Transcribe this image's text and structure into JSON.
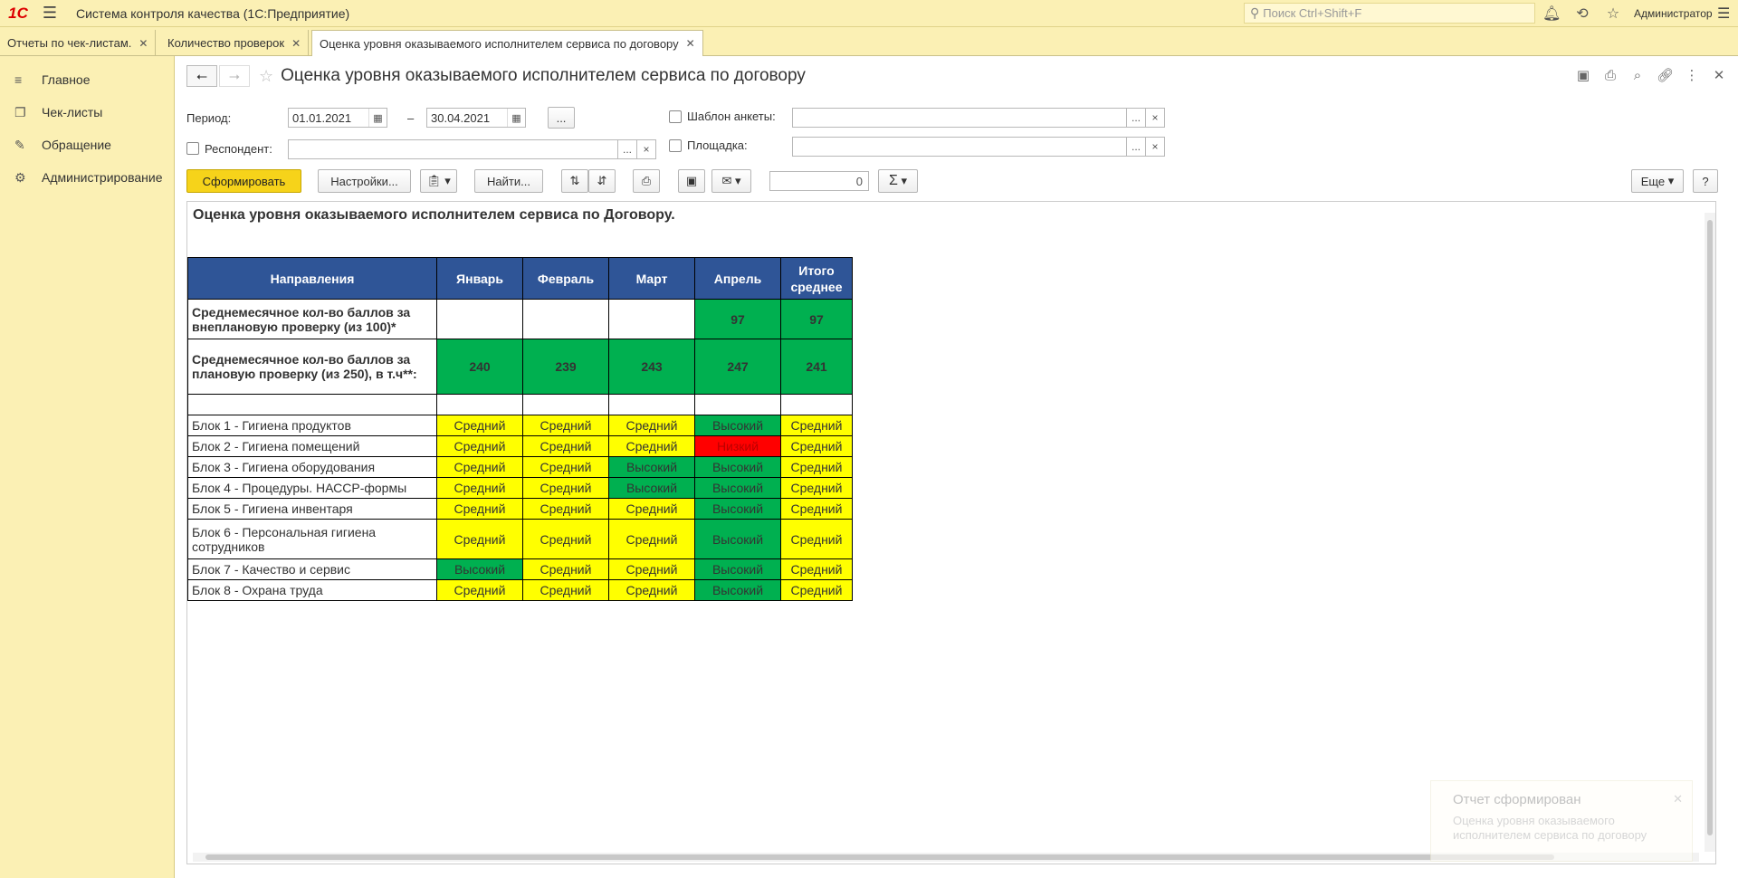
{
  "app": {
    "logo": "1С",
    "title": "Система контроля качества  (1С:Предприятие)",
    "search_placeholder": "Поиск Ctrl+Shift+F",
    "user": "Администратор"
  },
  "tabs": [
    {
      "label": "Отчеты по чек-листам."
    },
    {
      "label": "Количество проверок"
    },
    {
      "label": "Оценка уровня оказываемого исполнителем сервиса по договору"
    }
  ],
  "sidebar": {
    "items": [
      {
        "label": "Главное"
      },
      {
        "label": "Чек-листы"
      },
      {
        "label": "Обращение"
      },
      {
        "label": "Администрирование"
      }
    ]
  },
  "page": {
    "title": "Оценка уровня оказываемого исполнителем сервиса по договору"
  },
  "filters": {
    "period_label": "Период:",
    "date_from": "01.01.2021",
    "dash": "–",
    "date_to": "30.04.2021",
    "respondent_label": "Респондент:",
    "respondent_value": "",
    "template_label": "Шаблон анкеты:",
    "template_value": "",
    "site_label": "Площадка:",
    "site_value": "",
    "dots": "...",
    "clear": "×"
  },
  "toolbar": {
    "generate": "Сформировать",
    "settings": "Настройки...",
    "find": "Найти...",
    "counter": "0",
    "sum": "Σ",
    "more": "Еще",
    "help": "?"
  },
  "report": {
    "title": "Оценка уровня оказываемого исполнителем сервиса по Договору.",
    "headers": [
      "Направления",
      "Январь",
      "Февраль",
      "Март",
      "Апрель",
      "Итого среднее"
    ],
    "rows": [
      {
        "name": "Среднемесячное кол-во баллов за внеплановую проверку (из 100)*",
        "values": [
          "",
          "",
          "",
          "97",
          "97"
        ]
      },
      {
        "name": "Среднемесячное кол-во баллов за плановую проверку (из 250), в т.ч**:",
        "values": [
          "240",
          "239",
          "243",
          "247",
          "241"
        ]
      },
      {
        "name": "",
        "values": [
          "",
          "",
          "",
          "",
          ""
        ]
      },
      {
        "name": "Блок 1 - Гигиена продуктов",
        "values": [
          "Средний",
          "Средний",
          "Средний",
          "Высокий",
          "Средний"
        ]
      },
      {
        "name": "Блок 2 - Гигиена помещений",
        "values": [
          "Средний",
          "Средний",
          "Средний",
          "Низкий",
          "Средний"
        ]
      },
      {
        "name": "Блок 3 - Гигиена оборудования",
        "values": [
          "Средний",
          "Средний",
          "Высокий",
          "Высокий",
          "Средний"
        ]
      },
      {
        "name": "Блок 4 - Процедуры. НАССР-формы",
        "values": [
          "Средний",
          "Средний",
          "Высокий",
          "Высокий",
          "Средний"
        ]
      },
      {
        "name": "Блок 5 - Гигиена инвентаря",
        "values": [
          "Средний",
          "Средний",
          "Средний",
          "Высокий",
          "Средний"
        ]
      },
      {
        "name": "Блок 6 - Персональная гигиена сотрудников",
        "values": [
          "Средний",
          "Средний",
          "Средний",
          "Высокий",
          "Средний"
        ]
      },
      {
        "name": "Блок 7 - Качество и сервис",
        "values": [
          "Высокий",
          "Средний",
          "Средний",
          "Высокий",
          "Средний"
        ]
      },
      {
        "name": "Блок 8 - Охрана труда",
        "values": [
          "Средний",
          "Средний",
          "Средний",
          "Высокий",
          "Средний"
        ]
      }
    ]
  },
  "toast": {
    "title": "Отчет сформирован",
    "text": "Оценка уровня оказываемого исполнителем сервиса по договору"
  }
}
